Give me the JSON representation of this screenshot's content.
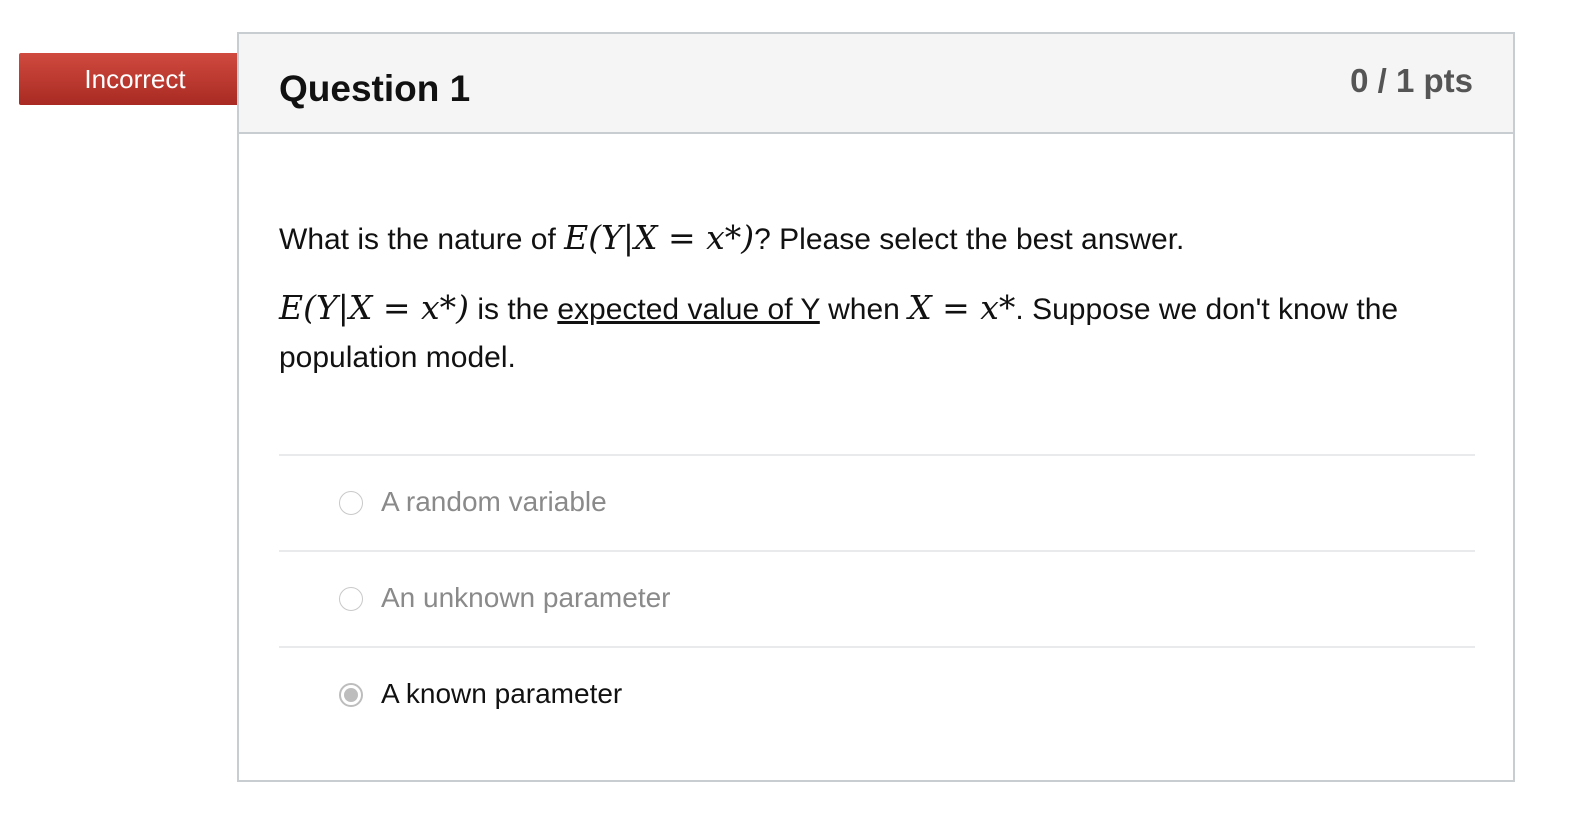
{
  "status_badge": {
    "label": "Incorrect",
    "color": "#c0392b"
  },
  "question": {
    "title": "Question 1",
    "points": "0 / 1 pts",
    "prompt": {
      "before_math": "What is the nature of ",
      "math_expr": "E(Y|X = x*)",
      "after_math": "? Please select the best answer."
    },
    "description": {
      "math_expr_start": "E(Y|X = x*)",
      "text_1": " is the ",
      "underlined": "expected value of Y",
      "text_2": " when ",
      "math_expr_mid": "X = x*",
      "text_3": ". Suppose we don't know the population model."
    },
    "answers": [
      {
        "label": "A random variable",
        "selected": false
      },
      {
        "label": "An unknown parameter",
        "selected": false
      },
      {
        "label": "A known parameter",
        "selected": true
      }
    ]
  }
}
